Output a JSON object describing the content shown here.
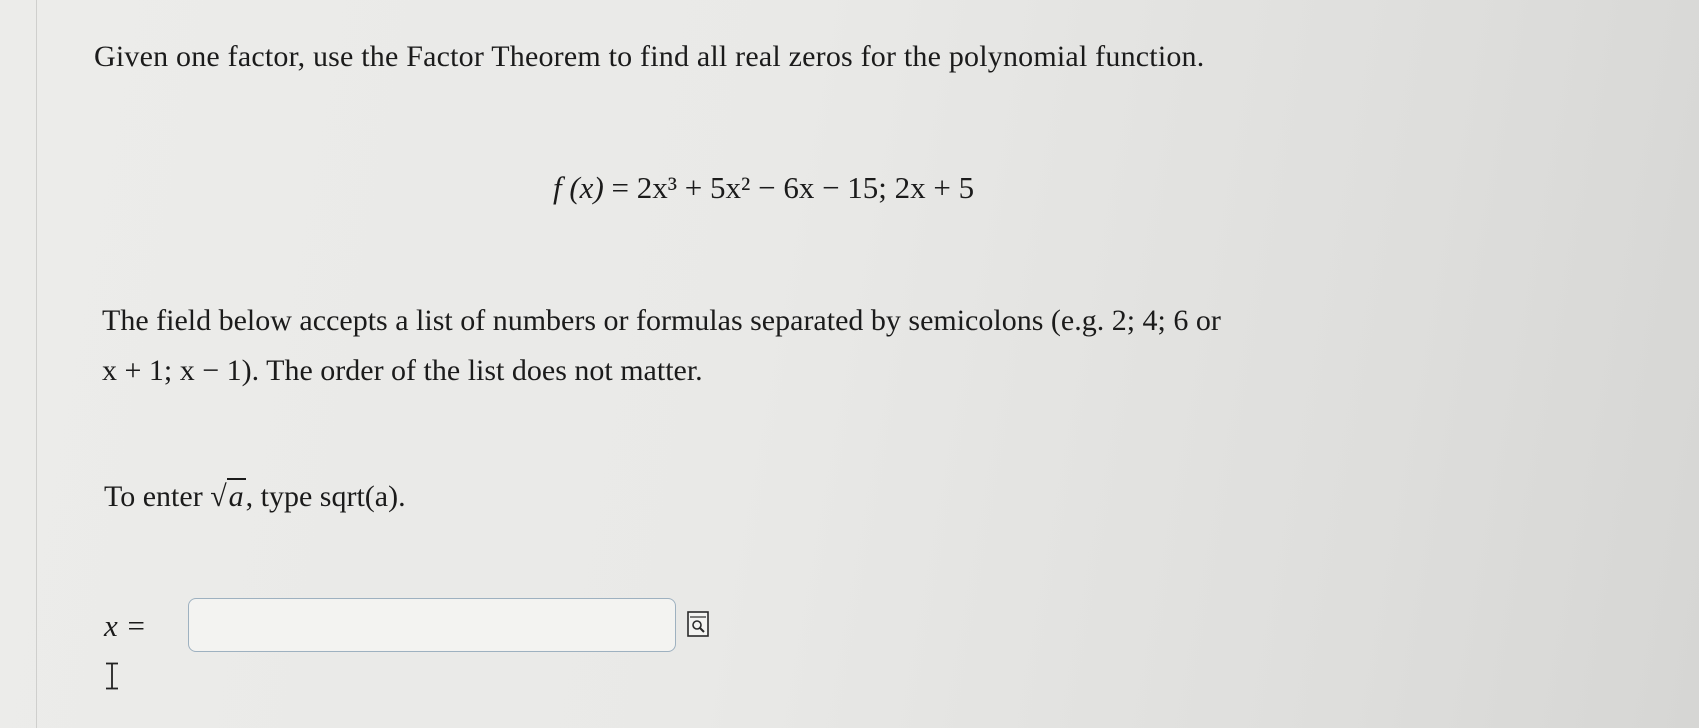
{
  "instruction": "Given one factor, use the Factor Theorem to find all real zeros for the  polynomial function.",
  "equation": {
    "fx": "f (x)",
    "rhs": " = 2x³ + 5x² − 6x − 15; 2x + 5"
  },
  "note": {
    "line1": "The field below accepts a list of numbers or formulas separated by semicolons (e.g. 2; 4; 6 or",
    "line2": "x + 1; x − 1). The order of the list does not matter."
  },
  "sqrt_hint": {
    "prefix": "To enter ",
    "symbol": "√",
    "arg": "a",
    "suffix": ", type sqrt(a)."
  },
  "answer": {
    "label": "x =",
    "value": "",
    "placeholder": ""
  },
  "icons": {
    "preview": "preview-magnifier-icon",
    "cursor": "text-cursor-ibeam-icon"
  },
  "colors": {
    "input_border": "#9eb1c0",
    "text": "#1b1b1b"
  }
}
